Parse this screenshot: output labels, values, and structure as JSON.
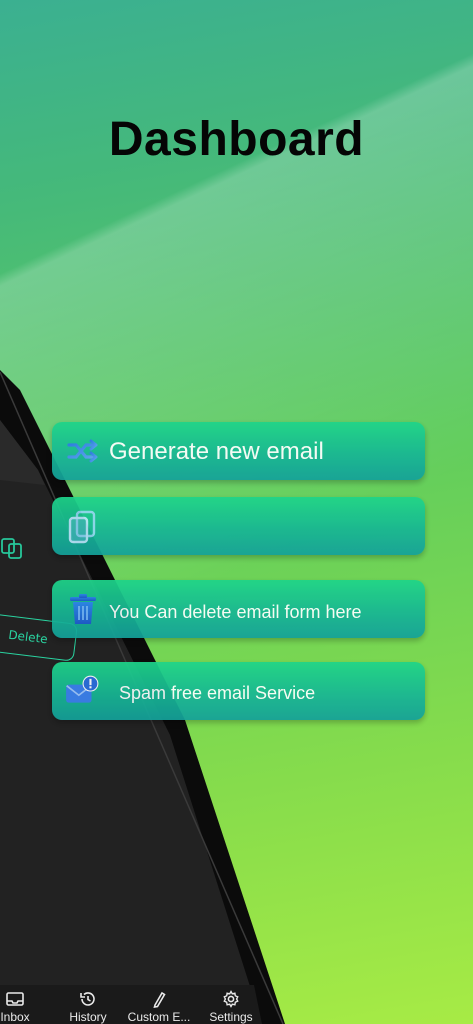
{
  "title": "Dashboard",
  "cards": [
    {
      "label": "Generate new email",
      "icon": "shuffle-icon"
    },
    {
      "label": "",
      "icon": "copy-icon"
    },
    {
      "label": "You Can delete email form here",
      "icon": "trash-icon"
    },
    {
      "label": "Spam free email Service",
      "icon": "mail-alert-icon"
    }
  ],
  "phone": {
    "delete_label": "Delete",
    "nav": [
      {
        "label": "Inbox",
        "icon": "inbox-icon"
      },
      {
        "label": "History",
        "icon": "history-icon"
      },
      {
        "label": "Custom E...",
        "icon": "pencil-icon"
      },
      {
        "label": "Settings",
        "icon": "gear-icon"
      }
    ]
  },
  "colors": {
    "card_top": "#1ed58a",
    "card_bottom": "#14a19a",
    "accent": "#2ad3a0"
  }
}
